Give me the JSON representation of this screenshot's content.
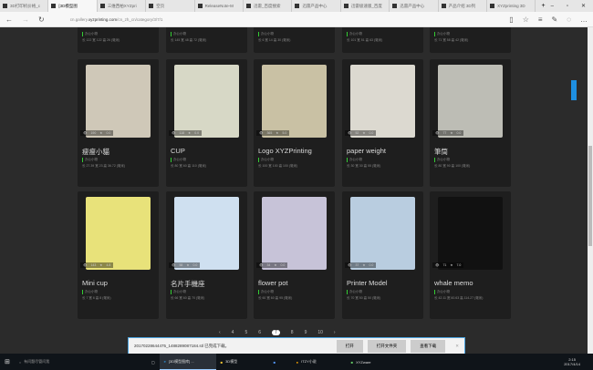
{
  "browser": {
    "tabs": [
      "3D打印机价格_c",
      "[3D模型图",
      "三维西柏XYZpri",
      "空页",
      "ReleaseNote-M",
      "迅雷_百度搜索",
      "迅雷产品中心",
      "迅雷极速版_百度",
      "迅雷产品中心",
      "产品介绍 3D列",
      "XYZprinting 3D"
    ],
    "url_prefix": "cn.gallery.",
    "url_host": "xyzprinting.com",
    "url_path": "/cn_zh_cn/category/3/7/1"
  },
  "top_partial": [
    {
      "cat": "办公小物",
      "dim": "长 122 宽 122 高 26 (毫米)"
    },
    {
      "cat": "办公小物",
      "dim": "长 145 宽 48 高 72 (毫米)"
    },
    {
      "cat": "办公小物",
      "dim": "长 6 宽 14 高 30 (毫米)"
    },
    {
      "cat": "办公小物",
      "dim": "长 101 宽 51 高 63 (毫米)"
    },
    {
      "cat": "办公小物",
      "dim": "长 71 宽 58 高 42 (毫米)"
    }
  ],
  "cards": [
    {
      "title": "瘦瘦小貓",
      "views": "190",
      "rating": "0.0",
      "cat": "办公小物",
      "dim": "长 27.39 宽 23 高 36.72 (毫米)",
      "bg": "#cfc8b8"
    },
    {
      "title": "CUP",
      "views": "118",
      "rating": "0.0",
      "cat": "办公小物",
      "dim": "长 80 宽 60 高 110 (毫米)",
      "bg": "#d7d8c6"
    },
    {
      "title": "Logo XYZPrinting",
      "views": "365",
      "rating": "5.0",
      "cat": "办公小物",
      "dim": "长 100 宽 100 高 100 (毫米)",
      "bg": "#c9c1a4"
    },
    {
      "title": "paper weight",
      "views": "52",
      "rating": "0.0",
      "cat": "办公小物",
      "dim": "长 30 宽 30 高 55 (毫米)",
      "bg": "#dcd9d0"
    },
    {
      "title": "筆筒",
      "views": "77",
      "rating": "0.0",
      "cat": "办公小物",
      "dim": "长 80 宽 90 高 100 (毫米)",
      "bg": "#bdbdb5"
    },
    {
      "title": "Mini cup",
      "views": "143",
      "rating": "4.8",
      "cat": "办公小物",
      "dim": "长 7 宽 6 高 8 (毫米)",
      "bg": "#e8e27a"
    },
    {
      "title": "名片手機座",
      "views": "58",
      "rating": "0.0",
      "cat": "办公小物",
      "dim": "长 66 宽 60 高 70 (毫米)",
      "bg": "#cfe0f0"
    },
    {
      "title": "flower pot",
      "views": "34",
      "rating": "0.0",
      "cat": "办公小物",
      "dim": "长 60 宽 60 高 95 (毫米)",
      "bg": "#c7c3d8"
    },
    {
      "title": "Printer Model",
      "views": "37",
      "rating": "0.0",
      "cat": "办公小物",
      "dim": "长 70 宽 50 高 50 (毫米)",
      "bg": "#b9cde0"
    },
    {
      "title": "whale memo",
      "views": "71",
      "rating": "7.0",
      "cat": "办公小物",
      "dim": "长 42.11 宽 60.63 高 114.27 (毫米)",
      "bg": "#111"
    }
  ],
  "pager": {
    "prev": "‹",
    "pages": [
      "4",
      "5",
      "6",
      "7",
      "8",
      "9",
      "10"
    ],
    "current": "7",
    "next": "›"
  },
  "download": {
    "file": "20170228644475_1488289087184.stl 已完成下载。",
    "open": "打开",
    "open_folder": "打开文件夹",
    "view": "查看下载",
    "close": "✕"
  },
  "taskbar": {
    "search": "有问题尽管问我",
    "apps": [
      "[3D模型图库] ...",
      "3D模型",
      "",
      "ITZY小说",
      "XYZware"
    ],
    "time": "2:15",
    "date": "2017/4/14"
  }
}
